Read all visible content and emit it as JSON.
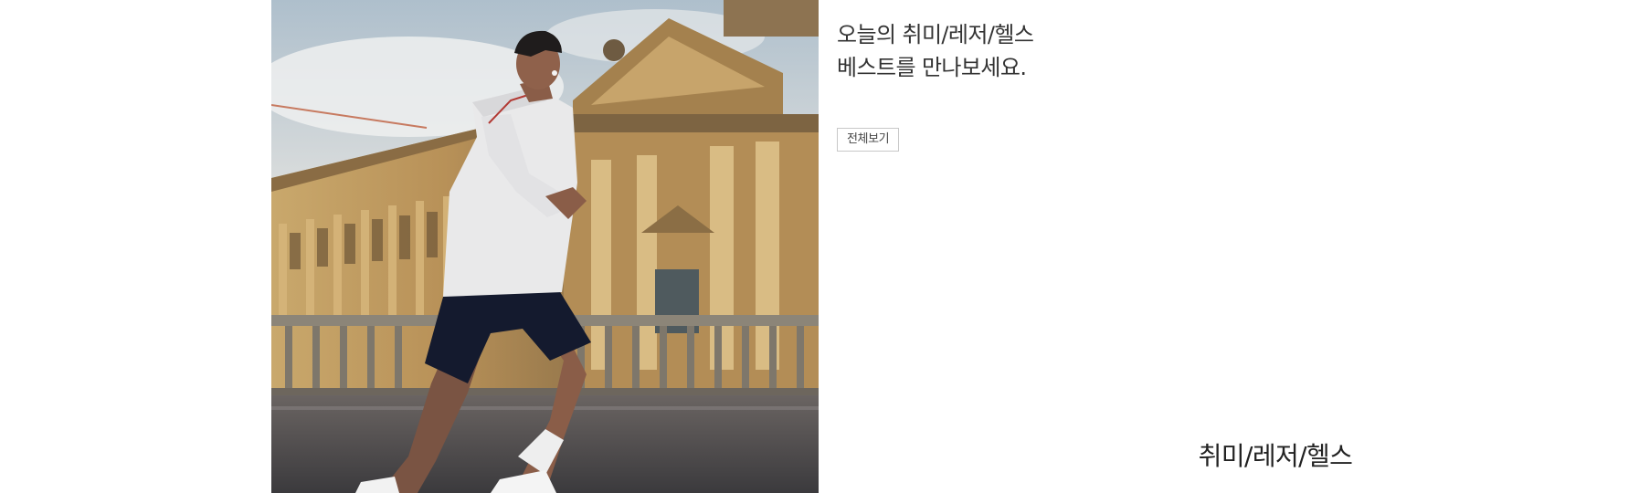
{
  "promo": {
    "headline_line1": "오늘의 취미/레저/헬스",
    "headline_line2": "베스트를 만나보세요.",
    "view_all_label": "전체보기"
  },
  "hero": {
    "image_subject": "runner-in-front-of-museum-photo"
  },
  "category": {
    "caption": "취미/레저/헬스"
  },
  "colors": {
    "text_primary": "#222222",
    "text_secondary": "#333333",
    "button_border": "#c8c8c8",
    "background": "#ffffff"
  }
}
